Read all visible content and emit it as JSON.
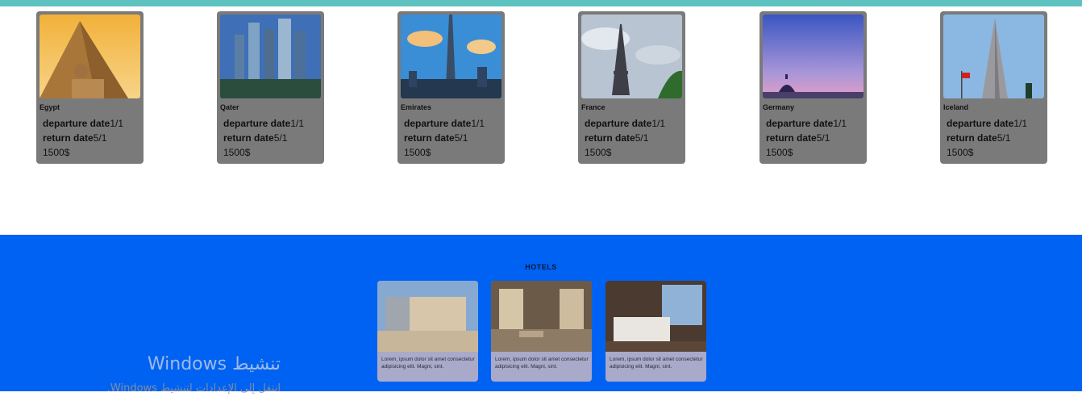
{
  "destinations": [
    {
      "name": "Egypt",
      "departure_label": "departure date",
      "departure_value": "1/1",
      "return_label": "return date",
      "return_value": "5/1",
      "price": "1500$"
    },
    {
      "name": "Qater",
      "departure_label": "departure date",
      "departure_value": "1/1",
      "return_label": "return date",
      "return_value": "5/1",
      "price": "1500$"
    },
    {
      "name": "Emirates",
      "departure_label": "departure date",
      "departure_value": "1/1",
      "return_label": "return date",
      "return_value": "5/1",
      "price": "1500$"
    },
    {
      "name": "France",
      "departure_label": "departure date",
      "departure_value": "1/1",
      "return_label": "return date",
      "return_value": "5/1",
      "price": "1500$"
    },
    {
      "name": "Germany",
      "departure_label": "departure date",
      "departure_value": "1/1",
      "return_label": "return date",
      "return_value": "5/1",
      "price": "1500$"
    },
    {
      "name": "Iceland",
      "departure_label": "departure date",
      "departure_value": "1/1",
      "return_label": "return date",
      "return_value": "5/1",
      "price": "1500$"
    }
  ],
  "hotels": {
    "title": "HOTELS",
    "cards": [
      {
        "text": "Lorem, ipsum dolor sit amet consectetur adipisicing elit. Magni, sint."
      },
      {
        "text": "Lorem, ipsum dolor sit amet consectetur adipisicing elit. Magni, sint."
      },
      {
        "text": "Lorem, ipsum dolor sit amet consectetur adipisicing elit. Magni, sint."
      }
    ]
  },
  "watermark": {
    "title": "تنشيط Windows",
    "subtitle": "انتقل إلى الإعدادات لتنشيط Windows."
  },
  "colors": {
    "top_bar": "#5ec3c0",
    "card_bg": "#7a7a7a",
    "hotels_bg": "#0062f2",
    "hotel_card_bg": "#a9a9c9"
  }
}
